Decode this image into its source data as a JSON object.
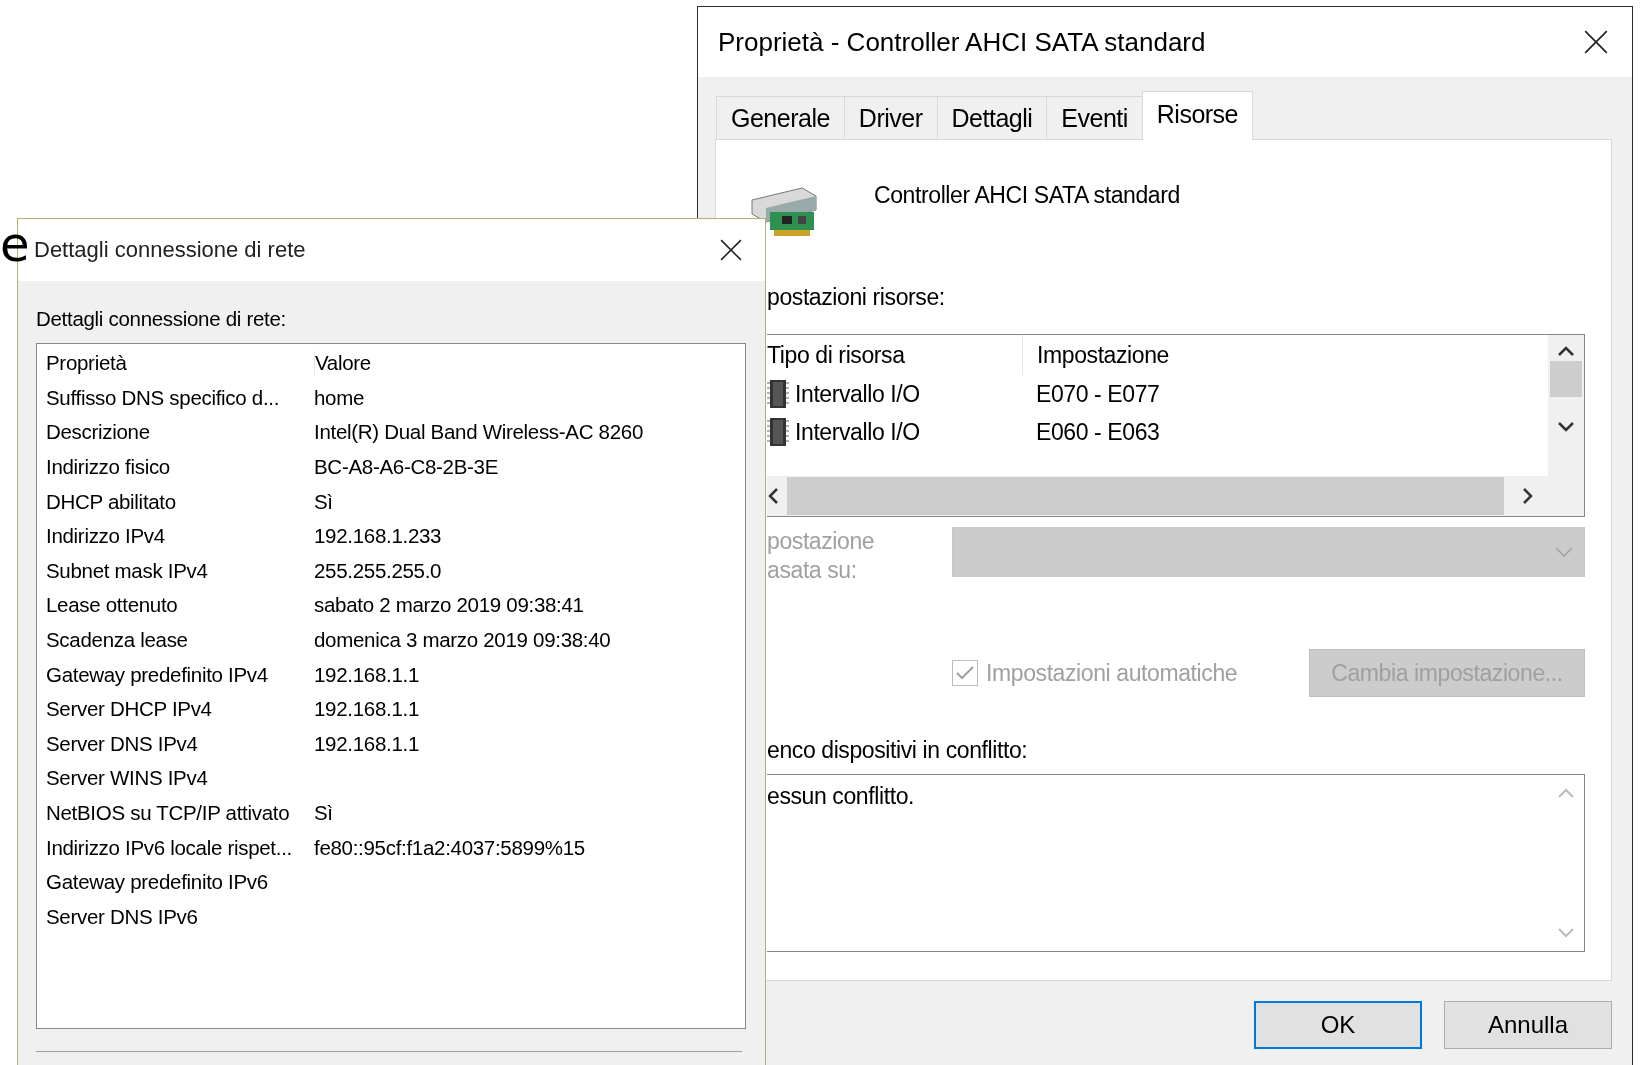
{
  "stray_text": "e",
  "properties_dialog": {
    "title": "Proprietà - Controller AHCI SATA standard",
    "tabs": [
      {
        "label": "Generale",
        "selected": false
      },
      {
        "label": "Driver",
        "selected": false
      },
      {
        "label": "Dettagli",
        "selected": false
      },
      {
        "label": "Eventi",
        "selected": false
      },
      {
        "label": "Risorse",
        "selected": true
      }
    ],
    "device_name": "Controller AHCI SATA standard",
    "resource_settings_label": "postazioni risorse:",
    "resource_table": {
      "columns": [
        "Tipo di risorsa",
        "Impostazione"
      ],
      "rows": [
        {
          "type": "Intervallo I/O",
          "setting": "E070 - E077"
        },
        {
          "type": "Intervallo I/O",
          "setting": "E060 - E063"
        }
      ]
    },
    "based_on": {
      "label_lines": [
        "postazione",
        "asata su:"
      ],
      "disabled": true
    },
    "automatic_settings": {
      "label": "Impostazioni automatiche",
      "checked": true,
      "disabled": true
    },
    "change_setting_button": {
      "label": "Cambia impostazione...",
      "disabled": true
    },
    "conflict_label": "enco dispositivi in conflitto:",
    "conflict_text": "essun conflitto.",
    "buttons": [
      {
        "label": "OK",
        "default": true
      },
      {
        "label": "Annulla",
        "default": false
      }
    ]
  },
  "network_dialog": {
    "title": "Dettagli connessione di rete",
    "label": "Dettagli connessione di rete:",
    "columns": [
      "Proprietà",
      "Valore"
    ],
    "rows": [
      {
        "property": "Suffisso DNS specifico d...",
        "value": "home"
      },
      {
        "property": "Descrizione",
        "value": "Intel(R) Dual Band Wireless-AC 8260"
      },
      {
        "property": "Indirizzo fisico",
        "value": "BC-A8-A6-C8-2B-3E"
      },
      {
        "property": "DHCP abilitato",
        "value": "Sì"
      },
      {
        "property": "Indirizzo IPv4",
        "value": "192.168.1.233"
      },
      {
        "property": "Subnet mask IPv4",
        "value": "255.255.255.0"
      },
      {
        "property": "Lease ottenuto",
        "value": "sabato 2 marzo 2019 09:38:41"
      },
      {
        "property": "Scadenza lease",
        "value": "domenica 3 marzo 2019 09:38:40"
      },
      {
        "property": "Gateway predefinito IPv4",
        "value": "192.168.1.1"
      },
      {
        "property": "Server DHCP IPv4",
        "value": "192.168.1.1"
      },
      {
        "property": "Server DNS IPv4",
        "value": "192.168.1.1"
      },
      {
        "property": "Server WINS IPv4"
      },
      {
        "property": "NetBIOS su TCP/IP attivato",
        "value": "Sì"
      },
      {
        "property": "Indirizzo IPv6 locale rispet...",
        "value": "fe80::95cf:f1a2:4037:5899%15"
      },
      {
        "property": "Gateway predefinito IPv6"
      },
      {
        "property": "Server DNS IPv6"
      }
    ]
  }
}
